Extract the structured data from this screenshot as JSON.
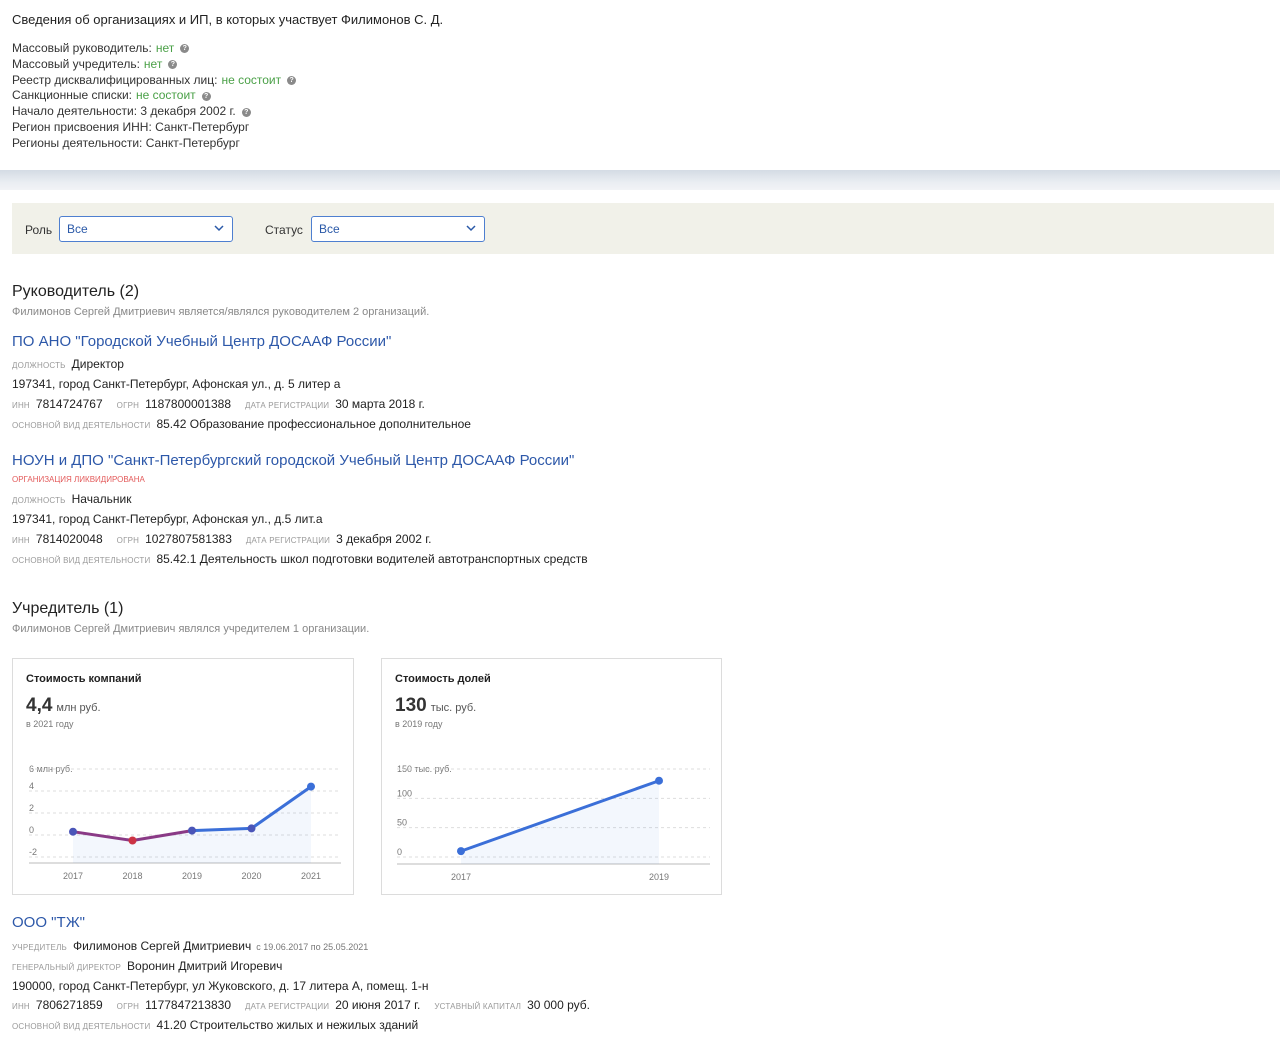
{
  "header": {
    "title": "Сведения об организациях и ИП, в которых участвует Филимонов С. Д.",
    "rows": [
      {
        "label": "Массовый руководитель:",
        "value": "нет",
        "green": true,
        "help": true
      },
      {
        "label": "Массовый учредитель:",
        "value": "нет",
        "green": true,
        "help": true
      },
      {
        "label": "Реестр дисквалифицированных лиц:",
        "value": "не состоит",
        "green": true,
        "help": true
      },
      {
        "label": "Санкционные списки:",
        "value": "не состоит",
        "green": true,
        "help": true
      },
      {
        "label": "Начало деятельности: 3 декабря 2002 г.",
        "value": "",
        "green": false,
        "help": true
      },
      {
        "label": "Регион присвоения ИНН: Санкт-Петербург",
        "value": "",
        "green": false,
        "help": false
      },
      {
        "label": "Регионы деятельности: Санкт-Петербург",
        "value": "",
        "green": false,
        "help": false
      }
    ]
  },
  "filters": {
    "role_label": "Роль",
    "role_value": "Все",
    "status_label": "Статус",
    "status_value": "Все"
  },
  "leader_section": {
    "title": "Руководитель (2)",
    "subtitle": "Филимонов Сергей Дмитриевич является/являлся руководителем 2 организаций."
  },
  "orgs_leader": [
    {
      "name": "ПО АНО \"Городской Учебный Центр ДОСААФ России\"",
      "liquidated": "",
      "position_label": "должность",
      "position": "Директор",
      "address": "197341, город Санкт-Петербург, Афонская ул., д. 5 литер а",
      "inn_label": "инн",
      "inn": "7814724767",
      "ogrn_label": "огрн",
      "ogrn": "1187800001388",
      "reg_label": "дата регистрации",
      "reg": "30 марта 2018 г.",
      "activity_label": "основной вид деятельности",
      "activity": "85.42 Образование профессиональное дополнительное"
    },
    {
      "name": "НОУН и ДПО \"Санкт-Петербургский городской Учебный Центр ДОСААФ России\"",
      "liquidated": "организация ликвидирована",
      "position_label": "должность",
      "position": "Начальник",
      "address": "197341, город Санкт-Петербург, Афонская ул., д.5 лит.а",
      "inn_label": "инн",
      "inn": "7814020048",
      "ogrn_label": "огрн",
      "ogrn": "1027807581383",
      "reg_label": "дата регистрации",
      "reg": "3 декабря 2002 г.",
      "activity_label": "основной вид деятельности",
      "activity": "85.42.1 Деятельность школ подготовки водителей автотранспортных средств"
    }
  ],
  "founder_section": {
    "title": "Учредитель (1)",
    "subtitle": "Филимонов Сергей Дмитриевич являлся учредителем 1 организации."
  },
  "cards": [
    {
      "title": "Стоимость компаний",
      "value": "4,4",
      "unit": "млн руб.",
      "year": "в 2021 году"
    },
    {
      "title": "Стоимость долей",
      "value": "130",
      "unit": "тыс. руб.",
      "year": "в 2019 году"
    }
  ],
  "chart_data": [
    {
      "type": "line",
      "title": "Стоимость компаний",
      "ylabel": "6 млн руб.",
      "x": [
        "2017",
        "2018",
        "2019",
        "2020",
        "2021"
      ],
      "yticks": [
        "4",
        "2",
        "0",
        "-2"
      ],
      "ylim": [
        -2,
        6
      ],
      "series": [
        {
          "values": [
            0.3,
            -0.5,
            0.4,
            0.6,
            4.4
          ]
        }
      ],
      "grid": true,
      "colors": {
        "line": "#3b6fd8",
        "negative": "#cc3344"
      }
    },
    {
      "type": "line",
      "title": "Стоимость долей",
      "ylabel": "150 тыс. руб.",
      "x": [
        "2017",
        "2019"
      ],
      "yticks": [
        "100",
        "50",
        "0"
      ],
      "ylim": [
        0,
        150
      ],
      "series": [
        {
          "values": [
            10,
            130
          ]
        }
      ],
      "grid": true,
      "colors": {
        "line": "#3b6fd8"
      }
    }
  ],
  "founder_org": {
    "name": "ООО \"ТЖ\"",
    "founder_label": "учредитель",
    "founder": "Филимонов Сергей Дмитриевич",
    "founder_period": "с 19.06.2017 по 25.05.2021",
    "director_label": "генеральный директор",
    "director": "Воронин Дмитрий Игоревич",
    "address": "190000, город Санкт-Петербург, ул Жуковского, д. 17 литера А, помещ. 1-н",
    "inn_label": "инн",
    "inn": "7806271859",
    "ogrn_label": "огрн",
    "ogrn": "1177847213830",
    "reg_label": "дата регистрации",
    "reg": "20 июня 2017 г.",
    "capital_label": "уставный капитал",
    "capital": "30 000 руб.",
    "activity_label": "основной вид деятельности",
    "activity": "41.20 Строительство жилых и нежилых зданий"
  }
}
